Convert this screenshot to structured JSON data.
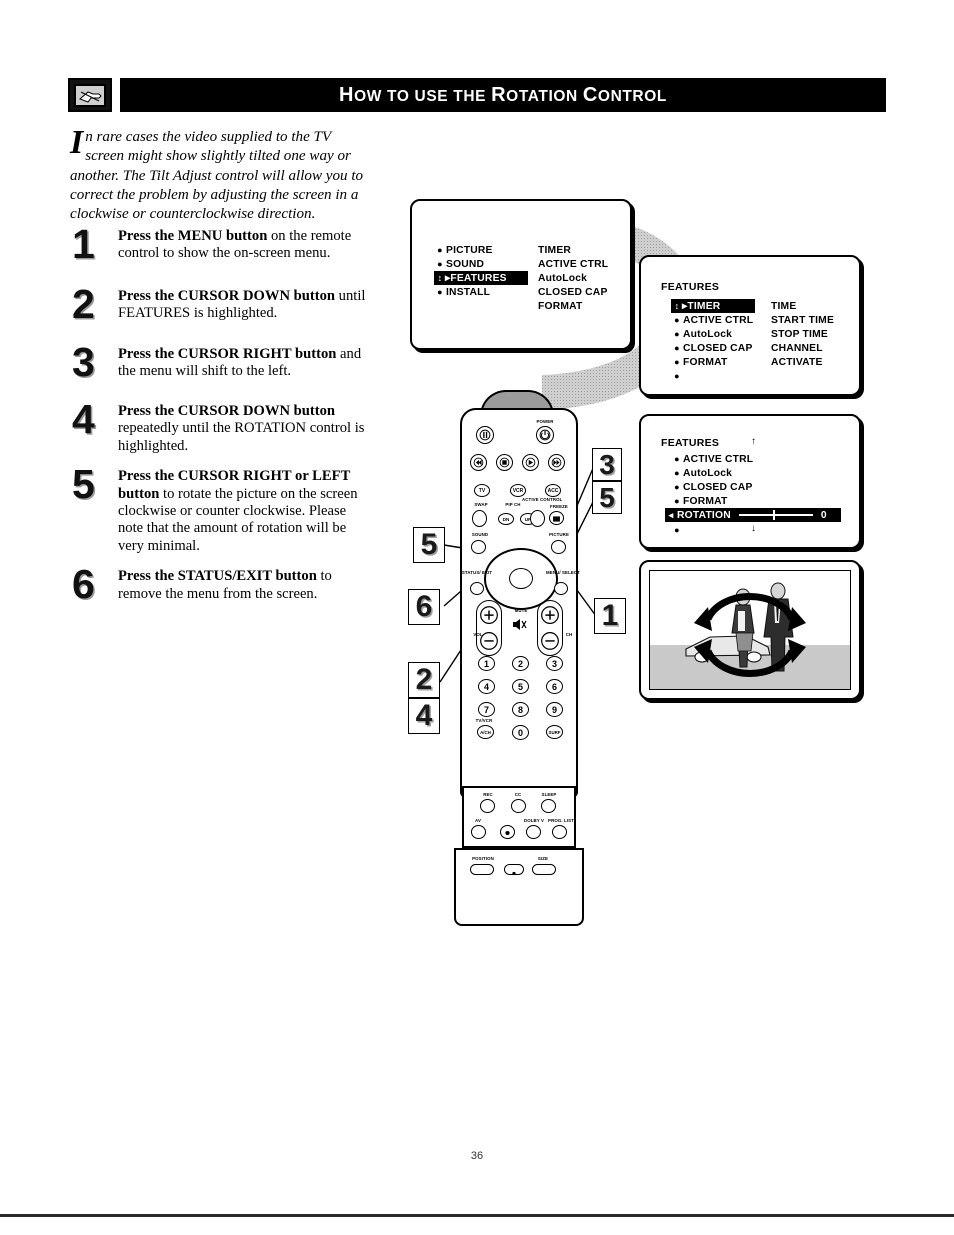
{
  "header": {
    "icon": "tv-hand-icon",
    "title_words": [
      "How",
      "to",
      "use",
      "the",
      "Rotation",
      "Control"
    ],
    "title": "How to use the Rotation Control"
  },
  "intro": {
    "dropcap": "I",
    "text": "n rare cases the video supplied to the TV screen might show slightly tilted one way or another. The Tilt Adjust control will allow you to correct the problem by adjusting the screen in a clockwise or counterclockwise direction."
  },
  "steps": [
    {
      "num": "1",
      "bold": "Press the MENU button",
      "rest": " on the remote control to show the on-screen menu."
    },
    {
      "num": "2",
      "bold": "Press the CURSOR DOWN button",
      "rest": " until FEATURES is highlighted."
    },
    {
      "num": "3",
      "bold": "Press the CURSOR RIGHT button",
      "rest": " and the menu will shift to the left."
    },
    {
      "num": "4",
      "bold": "Press the CURSOR DOWN button",
      "rest": " repeatedly until the ROTATION control is highlighted."
    },
    {
      "num": "5",
      "bold": "Press the CURSOR RIGHT or LEFT button",
      "rest": " to rotate the picture on the screen clockwise or counter clockwise. Please note that the amount of rotation will be very minimal."
    },
    {
      "num": "6",
      "bold": "Press the STATUS/EXIT button",
      "rest": " to remove the menu from the screen."
    }
  ],
  "menu1": {
    "left_items": [
      {
        "label": "PICTURE",
        "highlighted": false
      },
      {
        "label": "SOUND",
        "highlighted": false
      },
      {
        "label": "FEATURES",
        "highlighted": true
      },
      {
        "label": "INSTALL",
        "highlighted": false
      }
    ],
    "right_items": [
      "TIMER",
      "ACTIVE CTRL",
      "AutoLock",
      "CLOSED CAP",
      "FORMAT"
    ]
  },
  "menu2": {
    "title": "FEATURES",
    "left_items": [
      {
        "label": "TIMER",
        "highlighted": true
      },
      {
        "label": "ACTIVE CTRL",
        "highlighted": false
      },
      {
        "label": "AutoLock",
        "highlighted": false
      },
      {
        "label": "CLOSED CAP",
        "highlighted": false
      },
      {
        "label": "FORMAT",
        "highlighted": false
      },
      {
        "label": "",
        "highlighted": false
      }
    ],
    "right_items": [
      "TIME",
      "START TIME",
      "STOP TIME",
      "CHANNEL",
      "ACTIVATE"
    ]
  },
  "menu3": {
    "title": "FEATURES",
    "items": [
      {
        "label": "ACTIVE CTRL",
        "highlighted": false
      },
      {
        "label": "AutoLock",
        "highlighted": false
      },
      {
        "label": "CLOSED CAP",
        "highlighted": false
      },
      {
        "label": "FORMAT",
        "highlighted": false
      }
    ],
    "rotation": {
      "label": "ROTATION",
      "value": "0",
      "slider_position_pct": 46
    },
    "scroll_up": "↑",
    "scroll_down": "↓",
    "trailing_bullet": "●"
  },
  "photo": {
    "caption": "rotation-illustration",
    "description": "Two people walking with circular rotation arrows overlaid"
  },
  "remote": {
    "labels": {
      "power": "POWER",
      "tv": "TV",
      "vcr": "VCR",
      "acc": "ACC",
      "swap": "SWAP",
      "pip_ch": "PIP CH",
      "dn": "DN",
      "up": "UP",
      "active_control": "ACTIVE CONTROL",
      "freeze": "FREEZE",
      "sound": "SOUND",
      "picture": "PICTURE",
      "status_exit": "STATUS/ EXIT",
      "menu_select": "MENU/ SELECT",
      "vol": "VOL",
      "ch": "CH",
      "mute": "MUTE",
      "tv_vcr": "TV/VCR",
      "a_ch": "A/CH",
      "surf": "SURF",
      "rec": "REC",
      "cc": "CC",
      "sleep": "SLEEP",
      "av": "AV",
      "dolby_v": "DOLBY V",
      "prog_list": "PROG. LIST",
      "position": "POSITION",
      "size": "SIZE"
    },
    "keypad": [
      "1",
      "2",
      "3",
      "4",
      "5",
      "6",
      "7",
      "8",
      "9",
      "0"
    ]
  },
  "callouts": [
    {
      "id": "callout-5-left",
      "label": "5"
    },
    {
      "id": "callout-6",
      "label": "6"
    },
    {
      "id": "callout-2",
      "label": "2"
    },
    {
      "id": "callout-4",
      "label": "4"
    },
    {
      "id": "callout-1",
      "label": "1"
    },
    {
      "id": "callout-3-right",
      "label": "3"
    },
    {
      "id": "callout-5-right",
      "label": "5"
    }
  ],
  "footer": {
    "page_number": "36"
  }
}
